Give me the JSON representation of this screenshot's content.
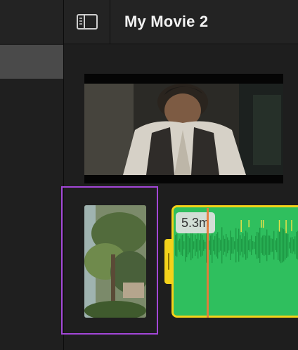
{
  "header": {
    "title": "My Movie 2",
    "sidebar_toggle_icon": "sidebar-toggle-icon"
  },
  "timeline": {
    "clip_duration": "5.3m",
    "selection_color": "#a347d8",
    "audio_clip_color": "#2fbf5e",
    "audio_clip_border": "#f4d21a",
    "playhead_color": "#e87b3a"
  }
}
